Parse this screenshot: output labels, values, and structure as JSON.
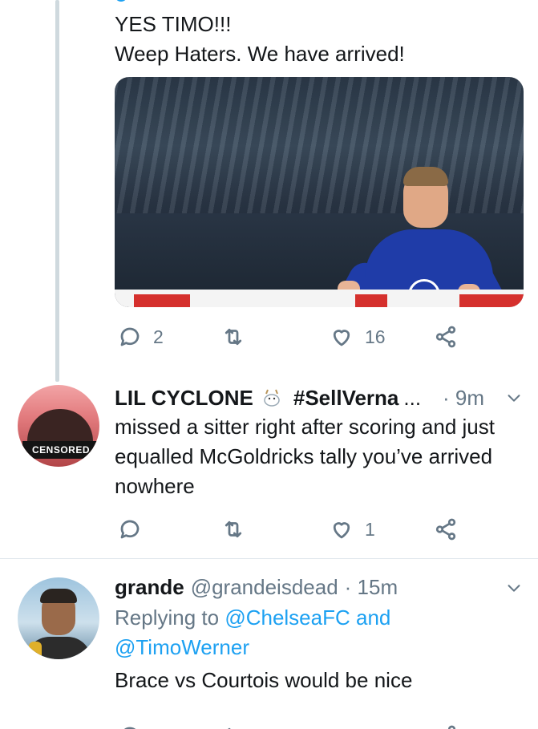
{
  "tweet1": {
    "line1": "YES TIMO!!!",
    "line2": "Weep Haters. We have arrived!",
    "image_alt": "Chelsea player celebrating",
    "replies": "2",
    "retweets": "",
    "likes": "16"
  },
  "tweet2": {
    "name": "LIL CYCLONE",
    "emoji": "goat-emoji",
    "tag": "#SellVerna",
    "ellipsis": "...",
    "time": "· 9m",
    "avatar_label": "CENSORED",
    "text": "missed a sitter right after scoring and just equalled McGoldricks tally you’ve arrived nowhere",
    "replies": "",
    "retweets": "",
    "likes": "1"
  },
  "tweet3": {
    "name": "grande",
    "handle": "@grandeisdead",
    "time": "· 15m",
    "replying_prefix": "Replying to",
    "mention1": "@ChelseaFC",
    "and_word": "and",
    "mention2": "@TimoWerner",
    "text": "Brace vs Courtois would be nice"
  },
  "colors": {
    "accent": "#1da1f2",
    "muted": "#657786",
    "text": "#14171a",
    "thread_line": "#cfd9de"
  }
}
